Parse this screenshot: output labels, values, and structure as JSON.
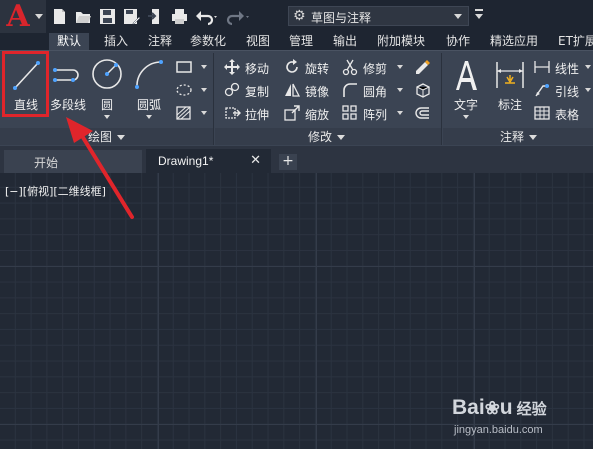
{
  "app": {
    "logo_letter": "A",
    "workspace_name": "草图与注释",
    "quick_access": [
      "new-icon",
      "open-icon",
      "save-icon",
      "save-as-icon",
      "export-icon",
      "plot-icon",
      "undo-icon",
      "redo-icon"
    ]
  },
  "ribbon_tabs": [
    {
      "label": "默认",
      "active": true
    },
    {
      "label": "插入"
    },
    {
      "label": "注释"
    },
    {
      "label": "参数化"
    },
    {
      "label": "视图"
    },
    {
      "label": "管理"
    },
    {
      "label": "输出"
    },
    {
      "label": "附加模块"
    },
    {
      "label": "协作"
    },
    {
      "label": "精选应用"
    },
    {
      "label": "ET扩展"
    }
  ],
  "draw_group": {
    "label": "绘图",
    "line": "直线",
    "polyline": "多段线",
    "circle": "圆",
    "arc": "圆弧"
  },
  "modify_group": {
    "label": "修改",
    "move": "移动",
    "rotate": "旋转",
    "trim": "修剪",
    "copy": "复制",
    "mirror": "镜像",
    "fillet": "圆角",
    "stretch": "拉伸",
    "scale": "缩放",
    "array": "阵列"
  },
  "annotate_group": {
    "label": "注释",
    "text": "文字",
    "dimension": "标注",
    "linear": "线性",
    "leader": "引线",
    "table": "表格"
  },
  "file_tabs": {
    "start": "开始",
    "drawing": "Drawing1*",
    "close": "✕",
    "add": "+"
  },
  "viewport": {
    "label": "[−][俯视][二维线框]"
  },
  "watermark": {
    "brand": "Bai",
    "brand_end": "u",
    "brand_cn": "经验",
    "url": "jingyan.baidu.com"
  },
  "colors": {
    "accent_red": "#e0252b",
    "ribbon_bg": "#3b4453",
    "canvas_bg": "#222935"
  }
}
